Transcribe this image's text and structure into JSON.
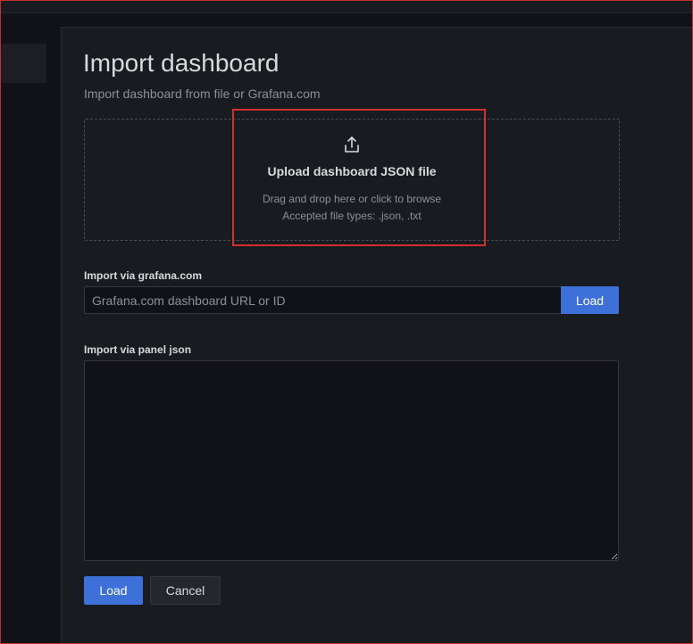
{
  "page": {
    "title": "Import dashboard",
    "subtitle": "Import dashboard from file or Grafana.com"
  },
  "upload": {
    "icon": "upload-icon",
    "title": "Upload dashboard JSON file",
    "hint": "Drag and drop here or click to browse",
    "accepted": "Accepted file types: .json, .txt"
  },
  "grafana_import": {
    "label": "Import via grafana.com",
    "placeholder": "Grafana.com dashboard URL or ID",
    "value": "",
    "button": "Load"
  },
  "panel_json": {
    "label": "Import via panel json",
    "value": ""
  },
  "actions": {
    "load": "Load",
    "cancel": "Cancel"
  },
  "colors": {
    "primary": "#3d71d9",
    "background": "#111217",
    "panel": "#181b1f",
    "highlight": "#d32f2f"
  }
}
